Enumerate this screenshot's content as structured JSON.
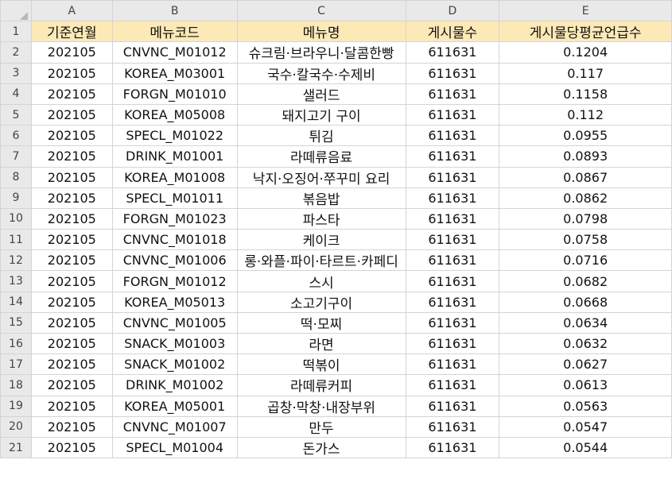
{
  "sheet": {
    "columns": [
      "A",
      "B",
      "C",
      "D",
      "E"
    ],
    "header": [
      "기준연월",
      "메뉴코드",
      "메뉴명",
      "게시물수",
      "게시물당평균언급수"
    ],
    "rows": [
      [
        "202105",
        "CNVNC_M01012",
        "슈크림·브라우니·달콤한빵",
        "611631",
        "0.1204"
      ],
      [
        "202105",
        "KOREA_M03001",
        "국수·칼국수·수제비",
        "611631",
        "0.117"
      ],
      [
        "202105",
        "FORGN_M01010",
        "샐러드",
        "611631",
        "0.1158"
      ],
      [
        "202105",
        "KOREA_M05008",
        "돼지고기 구이",
        "611631",
        "0.112"
      ],
      [
        "202105",
        "SPECL_M01022",
        "튀김",
        "611631",
        "0.0955"
      ],
      [
        "202105",
        "DRINK_M01001",
        "라떼류음료",
        "611631",
        "0.0893"
      ],
      [
        "202105",
        "KOREA_M01008",
        "낙지·오징어·쭈꾸미 요리",
        "611631",
        "0.0867"
      ],
      [
        "202105",
        "SPECL_M01011",
        "볶음밥",
        "611631",
        "0.0862"
      ],
      [
        "202105",
        "FORGN_M01023",
        "파스타",
        "611631",
        "0.0798"
      ],
      [
        "202105",
        "CNVNC_M01018",
        "케이크",
        "611631",
        "0.0758"
      ],
      [
        "202105",
        "CNVNC_M01006",
        "롱·와플·파이·타르트·카페디",
        "611631",
        "0.0716"
      ],
      [
        "202105",
        "FORGN_M01012",
        "스시",
        "611631",
        "0.0682"
      ],
      [
        "202105",
        "KOREA_M05013",
        "소고기구이",
        "611631",
        "0.0668"
      ],
      [
        "202105",
        "CNVNC_M01005",
        "떡·모찌",
        "611631",
        "0.0634"
      ],
      [
        "202105",
        "SNACK_M01003",
        "라면",
        "611631",
        "0.0632"
      ],
      [
        "202105",
        "SNACK_M01002",
        "떡볶이",
        "611631",
        "0.0627"
      ],
      [
        "202105",
        "DRINK_M01002",
        "라떼류커피",
        "611631",
        "0.0613"
      ],
      [
        "202105",
        "KOREA_M05001",
        "곱창·막창·내장부위",
        "611631",
        "0.0563"
      ],
      [
        "202105",
        "CNVNC_M01007",
        "만두",
        "611631",
        "0.0547"
      ],
      [
        "202105",
        "SPECL_M01004",
        "돈가스",
        "611631",
        "0.0544"
      ]
    ]
  }
}
